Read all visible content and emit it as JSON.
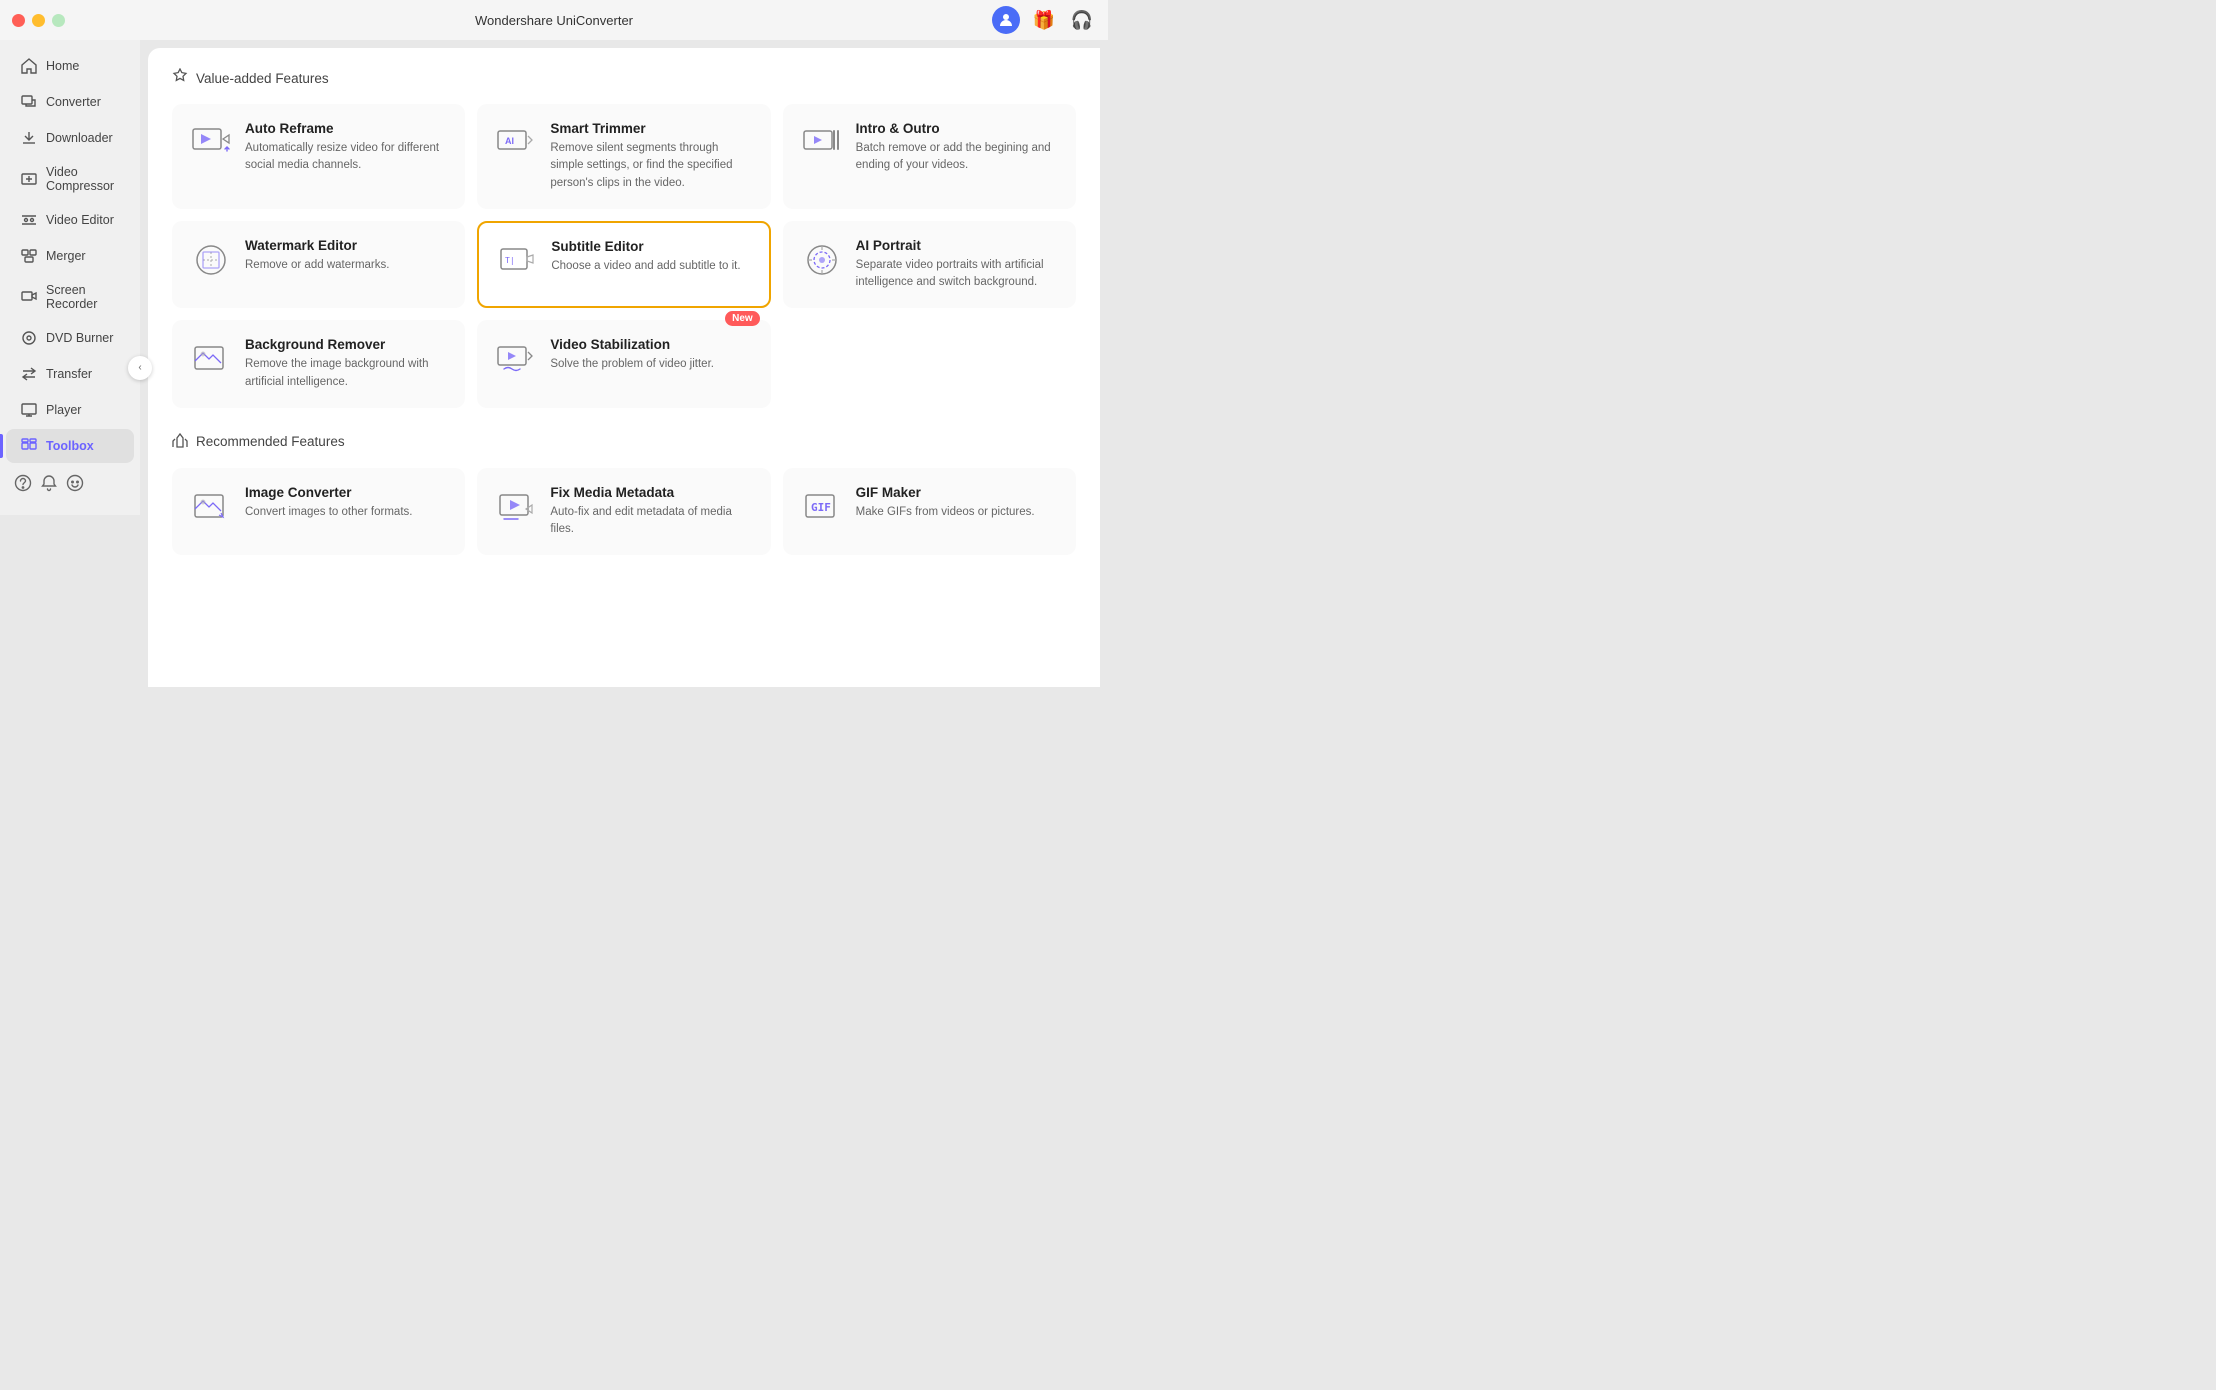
{
  "window": {
    "title": "Wondershare UniConverter"
  },
  "titlebar": {
    "user_icon_color": "#4a6cf7",
    "gift_icon": "🎁",
    "support_icon": "🎧"
  },
  "sidebar": {
    "items": [
      {
        "id": "home",
        "label": "Home",
        "icon": "home"
      },
      {
        "id": "converter",
        "label": "Converter",
        "icon": "converter"
      },
      {
        "id": "downloader",
        "label": "Downloader",
        "icon": "downloader"
      },
      {
        "id": "video-compressor",
        "label": "Video Compressor",
        "icon": "compressor"
      },
      {
        "id": "video-editor",
        "label": "Video Editor",
        "icon": "editor"
      },
      {
        "id": "merger",
        "label": "Merger",
        "icon": "merger"
      },
      {
        "id": "screen-recorder",
        "label": "Screen Recorder",
        "icon": "recorder"
      },
      {
        "id": "dvd-burner",
        "label": "DVD Burner",
        "icon": "dvd"
      },
      {
        "id": "transfer",
        "label": "Transfer",
        "icon": "transfer"
      },
      {
        "id": "player",
        "label": "Player",
        "icon": "player"
      },
      {
        "id": "toolbox",
        "label": "Toolbox",
        "icon": "toolbox",
        "active": true
      }
    ],
    "footer": {
      "help_icon": "?",
      "notification_icon": "🔔",
      "feedback_icon": "😊"
    }
  },
  "main": {
    "value_added_section": {
      "label": "Value-added Features",
      "features": [
        {
          "id": "auto-reframe",
          "title": "Auto Reframe",
          "desc": "Automatically resize video for different social media channels.",
          "icon": "auto-reframe",
          "selected": false,
          "badge": ""
        },
        {
          "id": "smart-trimmer",
          "title": "Smart Trimmer",
          "desc": "Remove silent segments through simple settings, or find the specified person's clips in the video.",
          "icon": "smart-trimmer",
          "selected": false,
          "badge": ""
        },
        {
          "id": "intro-outro",
          "title": "Intro & Outro",
          "desc": "Batch remove or add the begining and ending of your videos.",
          "icon": "intro-outro",
          "selected": false,
          "badge": ""
        },
        {
          "id": "watermark-editor",
          "title": "Watermark Editor",
          "desc": "Remove or add watermarks.",
          "icon": "watermark-editor",
          "selected": false,
          "badge": ""
        },
        {
          "id": "subtitle-editor",
          "title": "Subtitle Editor",
          "desc": "Choose a video and add subtitle to it.",
          "icon": "subtitle-editor",
          "selected": true,
          "badge": ""
        },
        {
          "id": "ai-portrait",
          "title": "AI Portrait",
          "desc": "Separate video portraits with artificial intelligence and switch background.",
          "icon": "ai-portrait",
          "selected": false,
          "badge": ""
        },
        {
          "id": "background-remover",
          "title": "Background Remover",
          "desc": "Remove the image background with artificial intelligence.",
          "icon": "background-remover",
          "selected": false,
          "badge": ""
        },
        {
          "id": "video-stabilization",
          "title": "Video Stabilization",
          "desc": "Solve the problem of video jitter.",
          "icon": "video-stabilization",
          "selected": false,
          "badge": "New"
        }
      ]
    },
    "recommended_section": {
      "label": "Recommended Features",
      "features": [
        {
          "id": "image-converter",
          "title": "Image Converter",
          "desc": "Convert images to other formats.",
          "icon": "image-converter",
          "badge": ""
        },
        {
          "id": "fix-media-metadata",
          "title": "Fix Media Metadata",
          "desc": "Auto-fix and edit metadata of media files.",
          "icon": "fix-media-metadata",
          "badge": ""
        },
        {
          "id": "gif-maker",
          "title": "GIF Maker",
          "desc": "Make GIFs from videos or pictures.",
          "icon": "gif-maker",
          "badge": ""
        }
      ]
    }
  }
}
